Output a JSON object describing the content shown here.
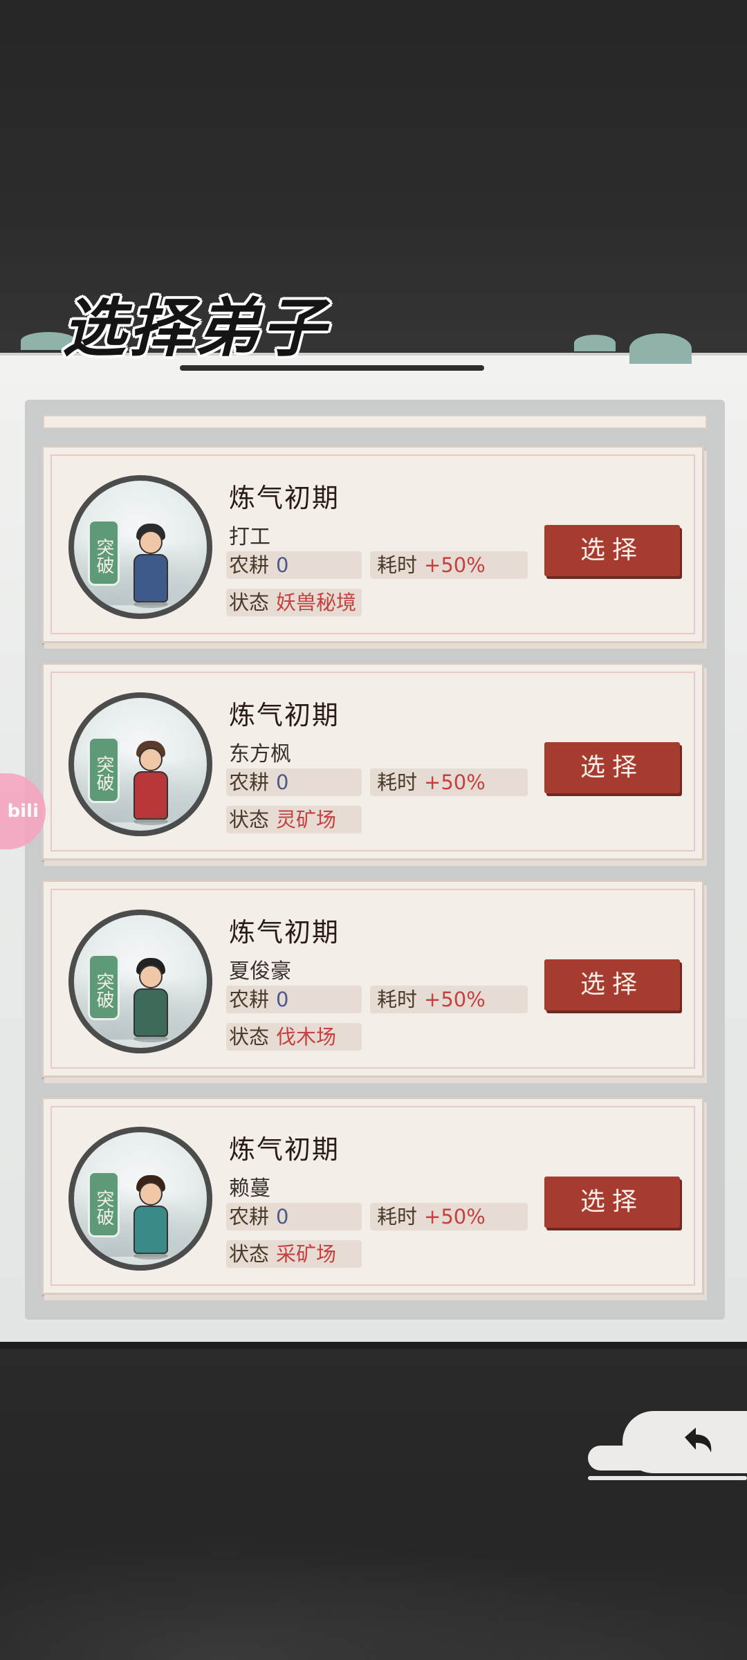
{
  "title": "选择弟子",
  "overlay_badge": "bili",
  "back_icon": "back-arrow-icon",
  "disciples": [
    {
      "realm": "炼气初期",
      "name": "打工",
      "badge": "突破",
      "farm_label": "农耕",
      "farm_value": "0",
      "time_label": "耗时",
      "time_value": "+50%",
      "state_label": "状态",
      "state_value": "妖兽秘境",
      "select_label": "选择",
      "robe_color": "#3d5a8a",
      "hair_color": "#2b2b2b"
    },
    {
      "realm": "炼气初期",
      "name": "东方枫",
      "badge": "突破",
      "farm_label": "农耕",
      "farm_value": "0",
      "time_label": "耗时",
      "time_value": "+50%",
      "state_label": "状态",
      "state_value": "灵矿场",
      "select_label": "选择",
      "robe_color": "#b8363a",
      "hair_color": "#5a3a2a"
    },
    {
      "realm": "炼气初期",
      "name": "夏俊豪",
      "badge": "突破",
      "farm_label": "农耕",
      "farm_value": "0",
      "time_label": "耗时",
      "time_value": "+50%",
      "state_label": "状态",
      "state_value": "伐木场",
      "select_label": "选择",
      "robe_color": "#3e6a5a",
      "hair_color": "#222222"
    },
    {
      "realm": "炼气初期",
      "name": "赖蔓",
      "badge": "突破",
      "farm_label": "农耕",
      "farm_value": "0",
      "time_label": "耗时",
      "time_value": "+50%",
      "state_label": "状态",
      "state_value": "采矿场",
      "select_label": "选择",
      "robe_color": "#3a8a8a",
      "hair_color": "#3a2418"
    }
  ]
}
